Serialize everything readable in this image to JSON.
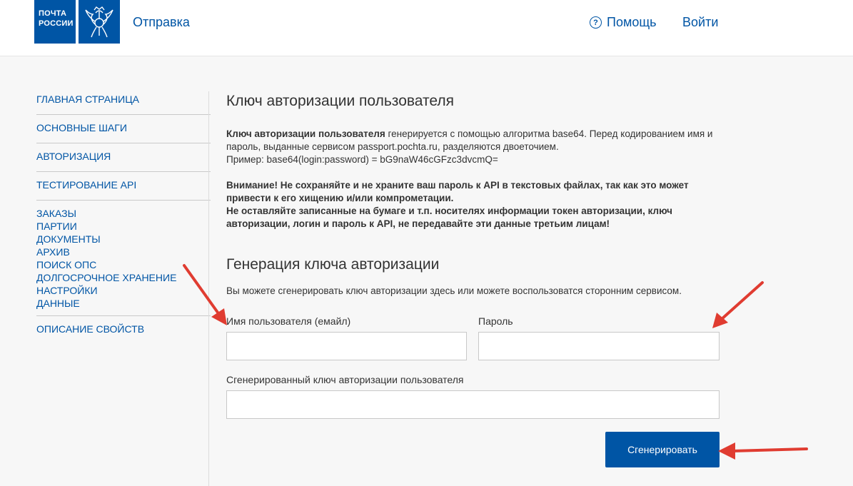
{
  "header": {
    "logo_line1": "ПОЧТА",
    "logo_line2": "РОССИИ",
    "brand_link": "Отправка",
    "help_icon": "?",
    "help_label": "Помощь",
    "login_label": "Войти"
  },
  "sidebar": {
    "items": [
      "ГЛАВНАЯ СТРАНИЦА",
      "ОСНОВНЫЕ ШАГИ",
      "АВТОРИЗАЦИЯ",
      "ТЕСТИРОВАНИЕ API",
      "ЗАКАЗЫ",
      "ПАРТИИ",
      "ДОКУМЕНТЫ",
      "АРХИВ",
      "ПОИСК ОПС",
      "ДОЛГОСРОЧНОЕ ХРАНЕНИЕ",
      "НАСТРОЙКИ",
      "ДАННЫЕ",
      "ОПИСАНИЕ СВОЙСТВ"
    ]
  },
  "main": {
    "title": "Ключ авторизации пользователя",
    "intro_bold": "Ключ авторизации пользователя",
    "intro_rest": " генерируется с помощью алгоритма base64. Перед кодированием имя и пароль, выданные сервисом passport.pochta.ru, разделяются двоеточием.",
    "example": "Пример: base64(login:password) = bG9naW46cGFzc3dvcmQ=",
    "warning_1": "Внимание! Не сохраняйте и не храните ваш пароль к API в текстовых файлах, так как это может привести к его хищению и/или компрометации.",
    "warning_2": "Не оставляйте записанные на бумаге и т.п. носителях информации токен авторизации, ключ авторизации, логин и пароль к API, не передавайте эти данные третьим лицам!",
    "gen_title": "Генерация ключа авторизации",
    "gen_desc": "Вы можете сгенерировать ключ авторизации здесь или можете воспользоватся сторонним сервисом.",
    "username_label": "Имя пользователя (емайл)",
    "username_value": "",
    "password_label": "Пароль",
    "password_value": "",
    "key_label": "Сгенерированный ключ авторизации пользователя",
    "key_value": "",
    "generate_button": "Сгенерировать"
  },
  "colors": {
    "brand": "#0055a5",
    "annotation_arrow": "#e03c31"
  }
}
